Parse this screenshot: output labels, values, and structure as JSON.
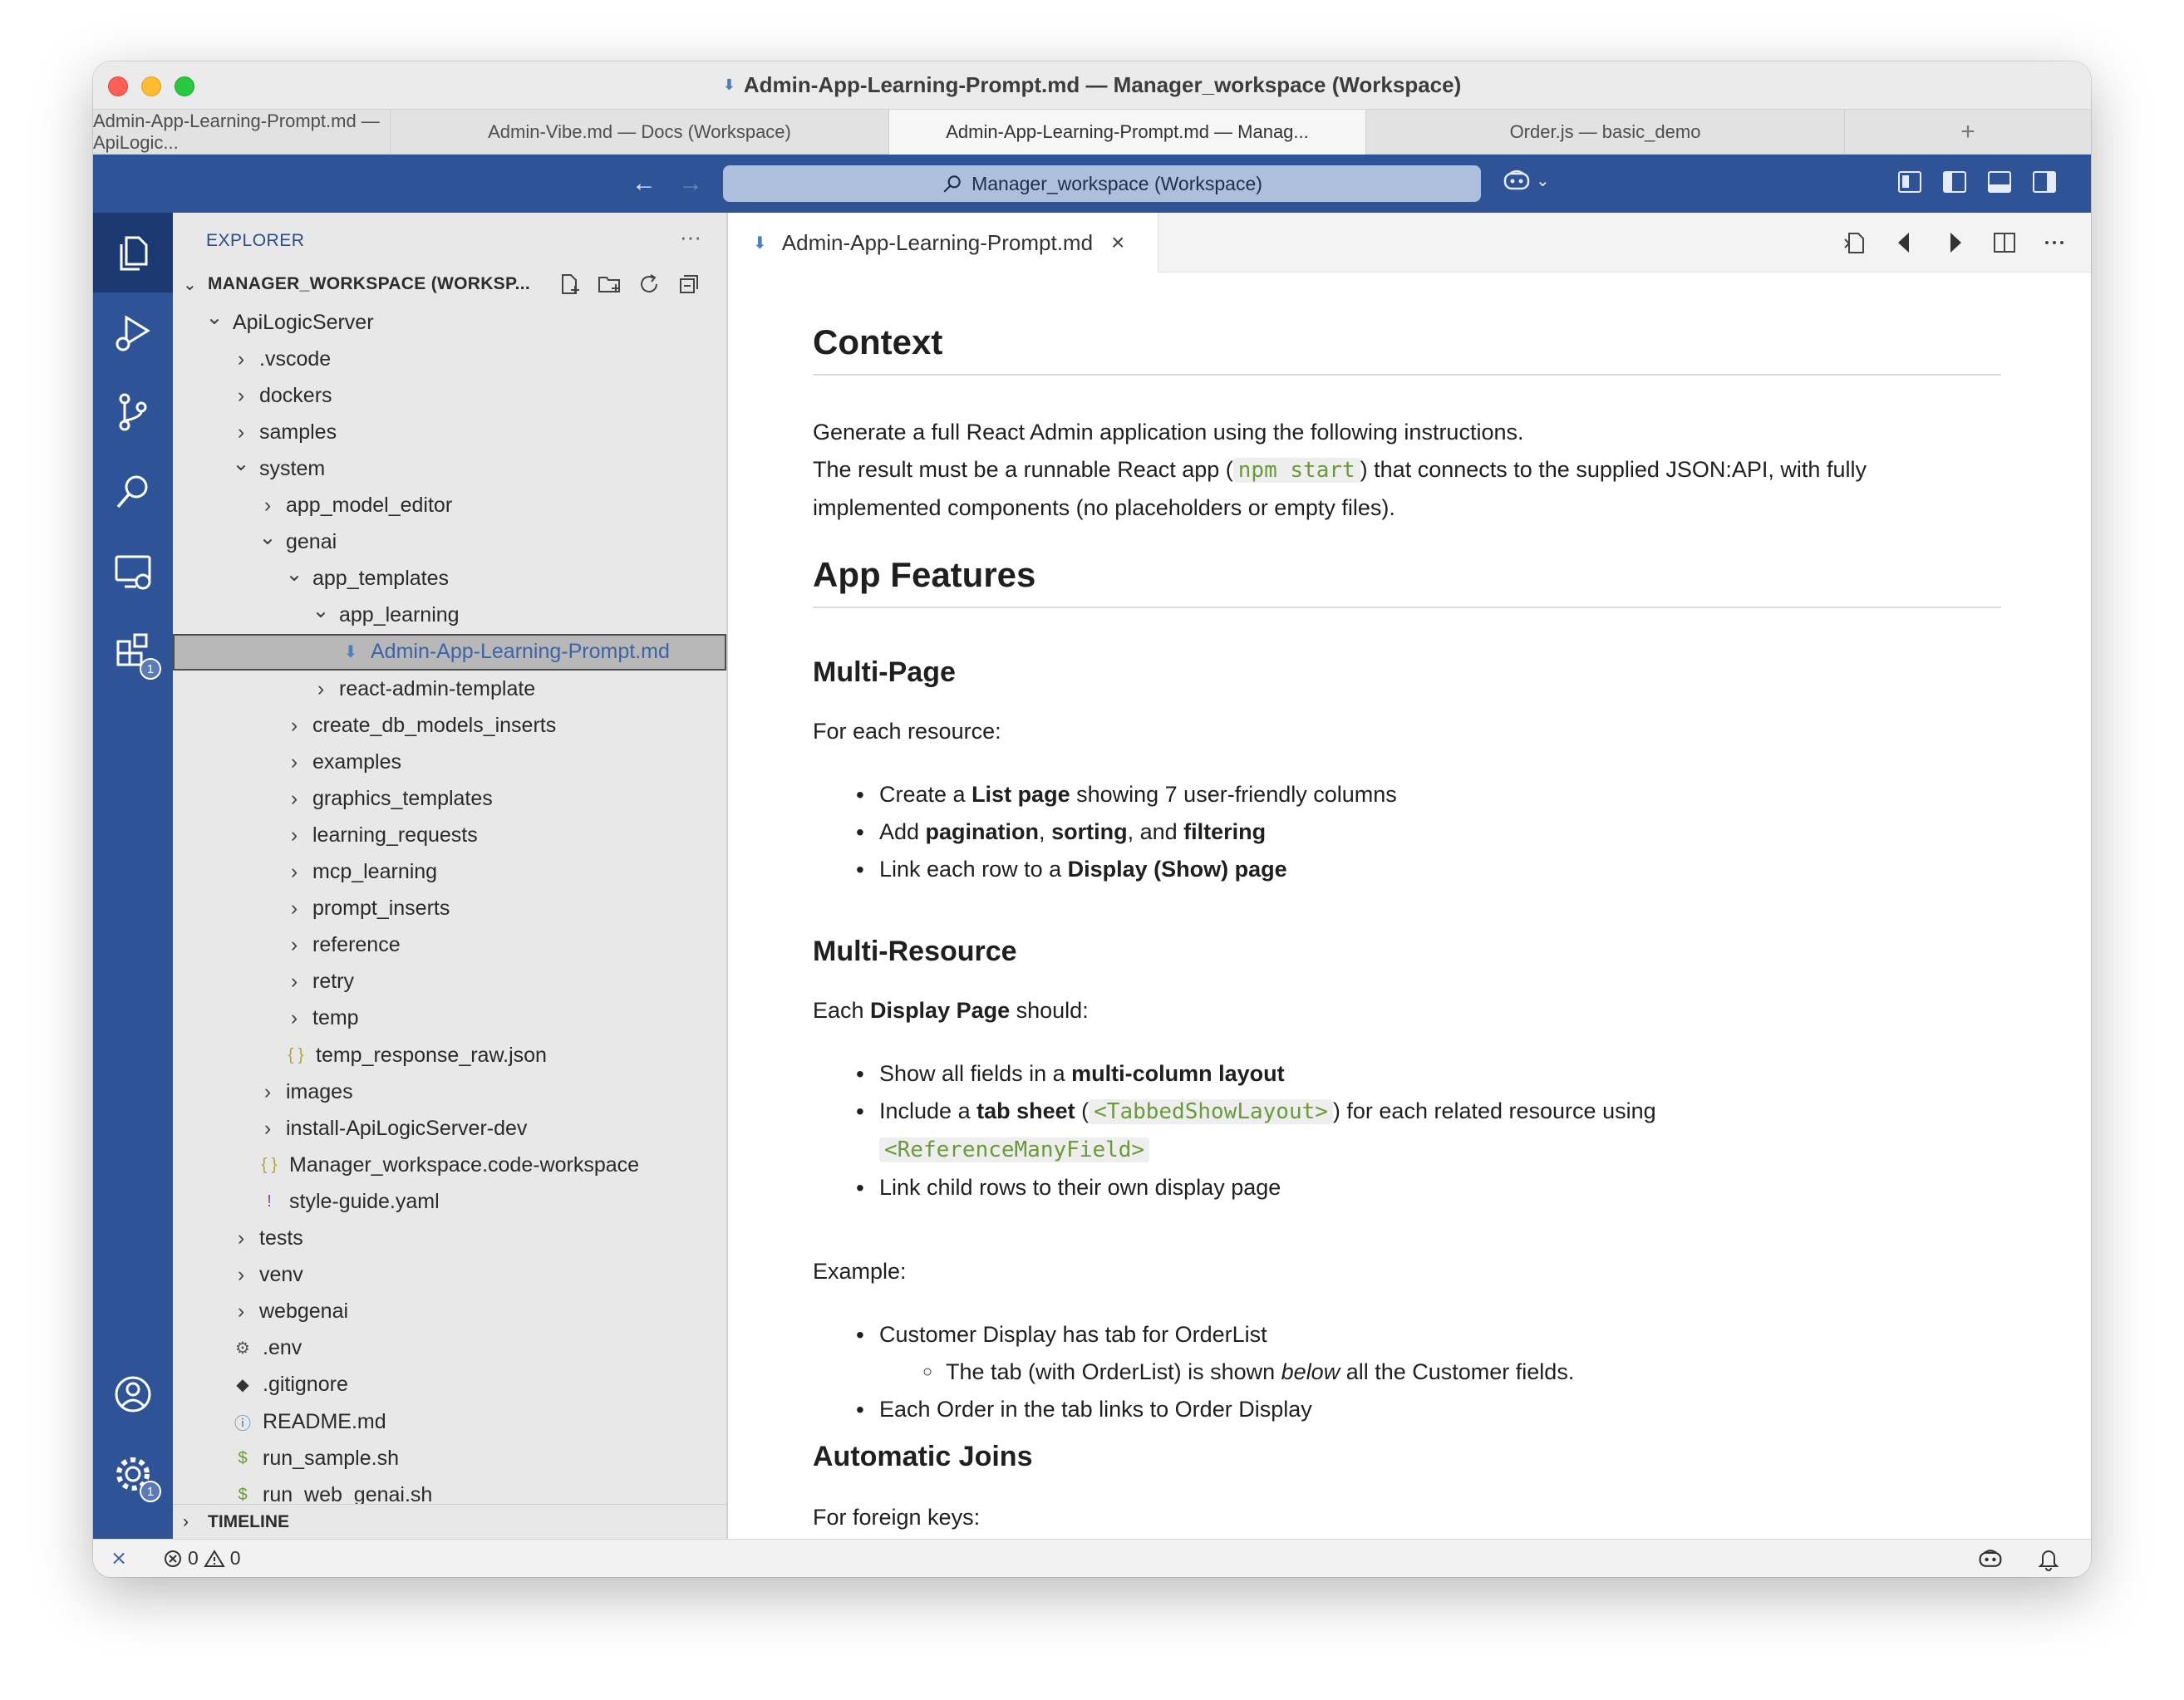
{
  "window": {
    "title": "Admin-App-Learning-Prompt.md — Manager_workspace (Workspace)"
  },
  "window_tabs": [
    {
      "label": "Admin-App-Learning-Prompt.md — ApiLogic..."
    },
    {
      "label": "Admin-Vibe.md — Docs (Workspace)"
    },
    {
      "label": "Admin-App-Learning-Prompt.md — Manag..."
    },
    {
      "label": "Order.js — basic_demo"
    }
  ],
  "command_center": {
    "search_label": "Manager_workspace (Workspace)"
  },
  "activity_bar": {
    "extensions_badge": "1",
    "settings_badge": "1"
  },
  "sidebar": {
    "title": "EXPLORER",
    "more": "···",
    "workspace_label": "MANAGER_WORKSPACE (WORKSP...",
    "timeline_label": "TIMELINE",
    "tree": [
      {
        "label": "ApiLogicServer",
        "chevron": "open",
        "icon": "",
        "depth": 0
      },
      {
        "label": ".vscode",
        "chevron": "closed",
        "icon": "",
        "depth": 1
      },
      {
        "label": "dockers",
        "chevron": "closed",
        "icon": "",
        "depth": 1
      },
      {
        "label": "samples",
        "chevron": "closed",
        "icon": "",
        "depth": 1
      },
      {
        "label": "system",
        "chevron": "open",
        "icon": "",
        "depth": 1
      },
      {
        "label": "app_model_editor",
        "chevron": "closed",
        "icon": "",
        "depth": 2
      },
      {
        "label": "genai",
        "chevron": "open",
        "icon": "",
        "depth": 2
      },
      {
        "label": "app_templates",
        "chevron": "open",
        "icon": "",
        "depth": 3
      },
      {
        "label": "app_learning",
        "chevron": "open",
        "icon": "",
        "depth": 4
      },
      {
        "label": "Admin-App-Learning-Prompt.md",
        "chevron": "none",
        "icon": "markdown",
        "depth": 5,
        "selected": true
      },
      {
        "label": "react-admin-template",
        "chevron": "closed",
        "icon": "",
        "depth": 4
      },
      {
        "label": "create_db_models_inserts",
        "chevron": "closed",
        "icon": "",
        "depth": 3
      },
      {
        "label": "examples",
        "chevron": "closed",
        "icon": "",
        "depth": 3
      },
      {
        "label": "graphics_templates",
        "chevron": "closed",
        "icon": "",
        "depth": 3
      },
      {
        "label": "learning_requests",
        "chevron": "closed",
        "icon": "",
        "depth": 3
      },
      {
        "label": "mcp_learning",
        "chevron": "closed",
        "icon": "",
        "depth": 3
      },
      {
        "label": "prompt_inserts",
        "chevron": "closed",
        "icon": "",
        "depth": 3
      },
      {
        "label": "reference",
        "chevron": "closed",
        "icon": "",
        "depth": 3
      },
      {
        "label": "retry",
        "chevron": "closed",
        "icon": "",
        "depth": 3
      },
      {
        "label": "temp",
        "chevron": "closed",
        "icon": "",
        "depth": 3
      },
      {
        "label": "temp_response_raw.json",
        "chevron": "none",
        "icon": "json",
        "depth": 3
      },
      {
        "label": "images",
        "chevron": "closed",
        "icon": "",
        "depth": 2
      },
      {
        "label": "install-ApiLogicServer-dev",
        "chevron": "closed",
        "icon": "",
        "depth": 2
      },
      {
        "label": "Manager_workspace.code-workspace",
        "chevron": "none",
        "icon": "json",
        "depth": 2
      },
      {
        "label": "style-guide.yaml",
        "chevron": "none",
        "icon": "yaml",
        "depth": 2
      },
      {
        "label": "tests",
        "chevron": "closed",
        "icon": "",
        "depth": 1
      },
      {
        "label": "venv",
        "chevron": "closed",
        "icon": "",
        "depth": 1
      },
      {
        "label": "webgenai",
        "chevron": "closed",
        "icon": "",
        "depth": 1
      },
      {
        "label": ".env",
        "chevron": "none",
        "icon": "gear",
        "depth": 1
      },
      {
        "label": ".gitignore",
        "chevron": "none",
        "icon": "git",
        "depth": 1
      },
      {
        "label": "README.md",
        "chevron": "none",
        "icon": "info",
        "depth": 1
      },
      {
        "label": "run_sample.sh",
        "chevron": "none",
        "icon": "shell",
        "depth": 1
      },
      {
        "label": "run_web_genai.sh",
        "chevron": "none",
        "icon": "shell",
        "depth": 1
      }
    ]
  },
  "editor": {
    "tab_label": "Admin-App-Learning-Prompt.md",
    "doc": {
      "h_context": "Context",
      "p1": "Generate a full React Admin application using the following instructions.",
      "p2_a": "The result must be a runnable React app (",
      "p2_code": "npm start",
      "p2_b": ") that connects to the supplied JSON:API, with fully",
      "p2_c": "implemented components (no placeholders or empty files).",
      "h_features": "App Features",
      "h_multipage": "Multi-Page",
      "for_each": "For each resource:",
      "mp1_a": "Create a ",
      "mp1_b": "List page",
      "mp1_c": " showing 7 user-friendly columns",
      "mp2_a": "Add ",
      "mp2_b": "pagination",
      "mp2_c": ", ",
      "mp2_d": "sorting",
      "mp2_e": ", and ",
      "mp2_f": "filtering",
      "mp3_a": "Link each row to a ",
      "mp3_b": "Display (Show) page",
      "h_multires": "Multi-Resource",
      "each_a": "Each ",
      "each_b": "Display Page",
      "each_c": " should:",
      "mr1_a": "Show all fields in a ",
      "mr1_b": "multi-column layout",
      "mr2_a": "Include a ",
      "mr2_b": "tab sheet",
      "mr2_c": " (",
      "mr2_code1": "<TabbedShowLayout>",
      "mr2_d": ") for each related resource using",
      "mr2_code2": "<ReferenceManyField>",
      "mr3": "Link child rows to their own display page",
      "example": "Example:",
      "ex1": "Customer Display has tab for OrderList",
      "ex1_sub_a": "The tab (with OrderList) is shown ",
      "ex1_sub_b": "below",
      "ex1_sub_c": " all the Customer fields.",
      "ex2": "Each Order in the tab links to Order Display",
      "h_joins": "Automatic Joins",
      "fk": "For foreign keys:"
    }
  },
  "statusbar": {
    "errors": "0",
    "warnings": "0"
  },
  "colors": {
    "accent": "#2e5396",
    "code": "#6a9a3a",
    "selected_label": "#3d63a8"
  }
}
